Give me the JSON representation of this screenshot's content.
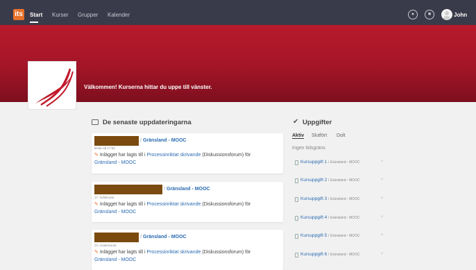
{
  "nav": {
    "logo_text": "its",
    "items": [
      "Start",
      "Kurser",
      "Grupper",
      "Kalender"
    ],
    "user_name": "John"
  },
  "banner": {
    "welcome": "Välkommen! Kurserna hittar du uppe till vänster."
  },
  "updates": {
    "title": "De senaste uppdateringarna",
    "cards": [
      {
        "course": "Gränsland - MOOC",
        "time": "tiistai vid 17:53",
        "text_before": "Inlägget har lagts till i",
        "forum": "Processinriktat skrivande",
        "text_after": "(Diskussionsforum) för",
        "course_link": "Gränsland - MOOC"
      },
      {
        "course": "Gränsland - MOOC",
        "time": "17. huhtikuuta",
        "text_before": "Inlägget har lagts till i",
        "forum": "Processinriktat skrivande",
        "text_after": "(Diskussionsforum) för",
        "course_link": "Gränsland - MOOC"
      },
      {
        "course": "Gränsland - MOOC",
        "time": "23. maaliskuuta",
        "text_before": "Inlägget har lagts till i",
        "forum": "Processinriktat skrivande",
        "text_after": "(Diskussionsforum) för",
        "course_link": "Gränsland - MOOC"
      }
    ]
  },
  "tasks": {
    "title": "Uppgifter",
    "tabs": [
      "Aktiv",
      "Slutfört",
      "Dolt"
    ],
    "no_deadline": "Ingen tidsgräns",
    "items": [
      {
        "name": "Kursuppgift 1",
        "course": "i Gränsland - MOOC"
      },
      {
        "name": "Kursuppgift 2",
        "course": "i Gränsland - MOOC"
      },
      {
        "name": "Kursuppgift 3",
        "course": "i Gränsland - MOOC"
      },
      {
        "name": "Kursuppgift 4",
        "course": "i Gränsland - MOOC"
      },
      {
        "name": "Kursuppgift 5",
        "course": "i Gränsland - MOOC"
      },
      {
        "name": "Kursuppgift 6",
        "course": "i Gränsland - MOOC"
      }
    ]
  },
  "colors": {
    "nav_bg": "#3a3b4a",
    "banner": "#b81b2c",
    "link": "#2a6ab2",
    "logo": "#e8722a"
  }
}
